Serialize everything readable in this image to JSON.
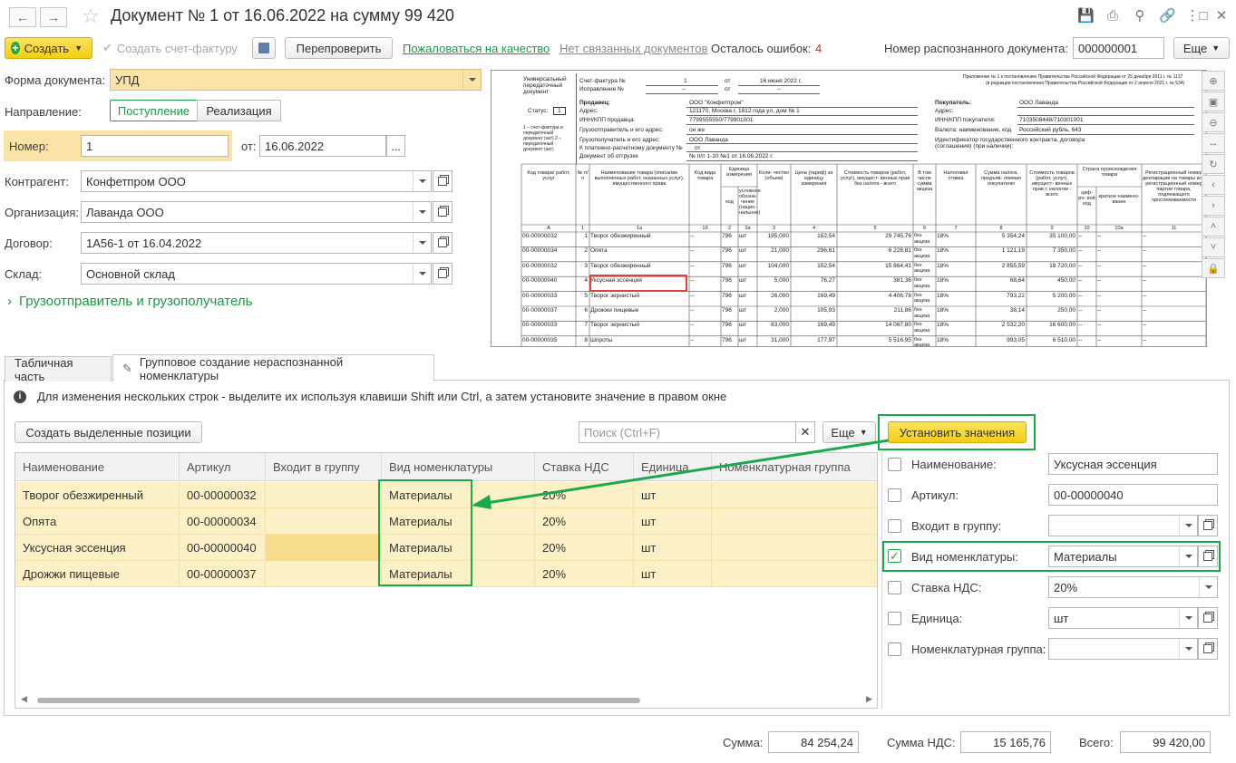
{
  "header": {
    "title": "Документ № 1 от 16.06.2022 на сумму 99 420",
    "icons": [
      "save-icon",
      "print-icon",
      "search-icon",
      "link-icon",
      "more-icon",
      "restore-icon",
      "close-icon"
    ]
  },
  "toolbar": {
    "create": "Создать",
    "create_invoice": "Создать счет-фактуру",
    "recheck": "Перепроверить",
    "complain": "Пожаловаться на качество",
    "no_linked": "Нет связанных документов",
    "errors_label": "Осталось ошибок:",
    "errors_value": "4",
    "recognized_label": "Номер распознанного документа:",
    "recognized_value": "000000001",
    "more": "Еще"
  },
  "form": {
    "doc_form_label": "Форма документа:",
    "doc_form_value": "УПД",
    "direction_label": "Направление:",
    "direction_in": "Поступление",
    "direction_out": "Реализация",
    "number_label": "Номер:",
    "number_value": "1",
    "date_label": "от:",
    "date_value": "16.06.2022",
    "counterparty_label": "Контрагент:",
    "counterparty_value": "Конфетпром ООО",
    "organization_label": "Организация:",
    "organization_value": "Лаванда ООО",
    "contract_label": "Договор:",
    "contract_value": "1А56-1 от 16.04.2022",
    "warehouse_label": "Склад:",
    "warehouse_value": "Основной склад",
    "shipper_link": "Грузоотправитель и грузополучатель"
  },
  "tabs": {
    "table": "Табличная часть",
    "group": "Групповое создание нераспознанной номенклатуры"
  },
  "group": {
    "hint": "Для изменения нескольких строк - выделите их используя клавиши Shift или Ctrl, а затем установите значение в правом окне",
    "create_selected": "Создать выделенные позиции",
    "search_placeholder": "Поиск (Ctrl+F)",
    "more": "Еще",
    "set_values": "Установить значения",
    "columns": [
      "Наименование",
      "Артикул",
      "Входит в группу",
      "Вид номенклатуры",
      "Ставка НДС",
      "Единица",
      "Номенклатурная группа"
    ],
    "rows": [
      {
        "name": "Творог обезжиренный",
        "sku": "00-00000032",
        "group": "",
        "kind": "Материалы",
        "vat": "20%",
        "unit": "шт",
        "ngroup": ""
      },
      {
        "name": "Опята",
        "sku": "00-00000034",
        "group": "",
        "kind": "Материалы",
        "vat": "20%",
        "unit": "шт",
        "ngroup": ""
      },
      {
        "name": "Уксусная эссенция",
        "sku": "00-00000040",
        "group": "",
        "kind": "Материалы",
        "vat": "20%",
        "unit": "шт",
        "ngroup": ""
      },
      {
        "name": "Дрожжи пищевые",
        "sku": "00-00000037",
        "group": "",
        "kind": "Материалы",
        "vat": "20%",
        "unit": "шт",
        "ngroup": ""
      }
    ]
  },
  "right_panel": {
    "name_label": "Наименование:",
    "name_value": "Уксусная эссенция",
    "sku_label": "Артикул:",
    "sku_value": "00-00000040",
    "group_label": "Входит в группу:",
    "group_value": "",
    "kind_label": "Вид номенклатуры:",
    "kind_value": "Материалы",
    "vat_label": "Ставка НДС:",
    "vat_value": "20%",
    "unit_label": "Единица:",
    "unit_value": "шт",
    "ngroup_label": "Номенклатурная группа:",
    "ngroup_value": ""
  },
  "totals": {
    "sum_label": "Сумма:",
    "sum_value": "84 254,24",
    "vat_label": "Сумма НДС:",
    "vat_value": "15 165,76",
    "total_label": "Всего:",
    "total_value": "99 420,00"
  },
  "preview": {
    "h_upd": "Универсальный передаточный документ",
    "h_invoice": "Счет-фактура №",
    "h_invoice_no": "1",
    "h_from": "от",
    "h_invoice_date": "16 июня 2022 г.",
    "h_fix": "Исправление №",
    "h_dash": "--",
    "h_appendix": "Приложение № 1 к постановлению Правительства Российской Федерации от 26 декабря 2011 г. № 1137",
    "h_appendix2": "(в редакции постановления Правительства Российской Федерации от 2 апреля 2021 г. № 534)",
    "status": "Статус:",
    "status_val": "1",
    "seller": "Продавец:",
    "seller_val": "ООО \"Конфетпром\"",
    "address": "Адрес:",
    "seller_addr": "121170, Москва г, 1812 года ул, дом № 1",
    "inn_seller": "ИНН/КПП продавца:",
    "inn_seller_val": "7799555550/779901001",
    "shipper": "Грузоотправитель и его адрес:",
    "shipper_val": "он же",
    "consignee": "Грузополучатель и его адрес:",
    "consignee_val": "ООО Лаванда",
    "payment": "К платежно-расчетному документу №",
    "payment_val": "от",
    "shipdoc": "Документ об отгрузке",
    "shipdoc_val": "№ п/п 1-10 №1 от 16.06.2022 г.",
    "buyer": "Покупатель:",
    "buyer_val": "ООО Лаванда",
    "inn_buyer": "ИНН/КПП покупателя:",
    "inn_buyer_val": "7103508448/710301001",
    "currency": "Валюта: наименование, код",
    "currency_val": "Российский рубль, 643",
    "gov_id": "Идентификатор государственного контракта, договора (соглашения) (при наличии):",
    "status_note": "1 – счет-фактура и передаточный документ (акт) 2 – передаточный документ (акт)",
    "cols": [
      "Код товара/ работ, услуг",
      "№ п/п",
      "Наименование товара (описание выполненных работ, оказанных услуг), имущественного права",
      "Код вида товара",
      "Единица измерения",
      "Коли- чество (объем)",
      "Цена (тариф) за единицу измерения",
      "Стоимость товаров (работ, услуг), имущест- венных прав без налога - всего",
      "В том числе сумма акциза",
      "Налоговая ставка",
      "Сумма налога, предъяв- ляемая покупателю",
      "Стоимость товаров (работ, услуг), имущест- венных прав с налогом - всего",
      "Страна происхождения товара",
      "Регистрационный номер декларации на товары или регистрационный номер партии товара, подлежащего прослеживаемости"
    ],
    "unit_sub": [
      "код",
      "условное обозна- чение (нацио- нальное)"
    ],
    "country_sub": [
      "циф- ро- вой код",
      "краткое наимено- вание"
    ],
    "colnums": [
      "А",
      "1",
      "1а",
      "1б",
      "2",
      "2а",
      "3",
      "4",
      "5",
      "6",
      "7",
      "8",
      "9",
      "10",
      "10а",
      "11"
    ],
    "rows": [
      [
        "00-00000032",
        "1",
        "Творог обезжиренный",
        "--",
        "796",
        "шт",
        "195,000",
        "152,54",
        "29 745,76",
        "без акциза",
        "18%",
        "5 354,24",
        "35 100,00",
        "--",
        "--",
        "--"
      ],
      [
        "00-00000034",
        "2",
        "Опята",
        "--",
        "796",
        "шт",
        "21,000",
        "296,61",
        "6 228,81",
        "без акциза",
        "18%",
        "1 121,19",
        "7 350,00",
        "--",
        "--",
        "--"
      ],
      [
        "00-00000032",
        "3",
        "Творог обезжиренный",
        "--",
        "796",
        "шт",
        "104,000",
        "152,54",
        "15 864,41",
        "без акциза",
        "18%",
        "2 855,59",
        "18 720,00",
        "--",
        "--",
        "--"
      ],
      [
        "00-00000040",
        "4",
        "Уксусная эссенция",
        "--",
        "796",
        "шт",
        "5,000",
        "76,27",
        "381,36",
        "без акциза",
        "18%",
        "68,64",
        "450,00",
        "--",
        "--",
        "--"
      ],
      [
        "00-00000033",
        "5",
        "Творог зернистый",
        "--",
        "796",
        "шт",
        "26,000",
        "169,49",
        "4 406,78",
        "без акциза",
        "18%",
        "793,22",
        "5 200,00",
        "--",
        "--",
        "--"
      ],
      [
        "00-00000037",
        "6",
        "Дрожжи пищевые",
        "--",
        "796",
        "шт",
        "2,000",
        "105,93",
        "211,86",
        "без акциза",
        "18%",
        "38,14",
        "250,00",
        "--",
        "--",
        "--"
      ],
      [
        "00-00000033",
        "7",
        "Творог зернистый",
        "--",
        "796",
        "шт",
        "83,000",
        "169,49",
        "14 067,80",
        "без акциза",
        "18%",
        "2 532,20",
        "16 600,00",
        "--",
        "--",
        "--"
      ],
      [
        "00-00000035",
        "8",
        "Шпроты",
        "--",
        "796",
        "шт",
        "31,000",
        "177,97",
        "5 516,95",
        "без акциза",
        "18%",
        "993,05",
        "6 510,00",
        "--",
        "--",
        "--"
      ]
    ]
  },
  "colors": {
    "accent_green": "#1aa94b",
    "yellow_button": "#f7d51b",
    "row_highlight": "#fbf0c6",
    "error_red": "#d9261c"
  }
}
